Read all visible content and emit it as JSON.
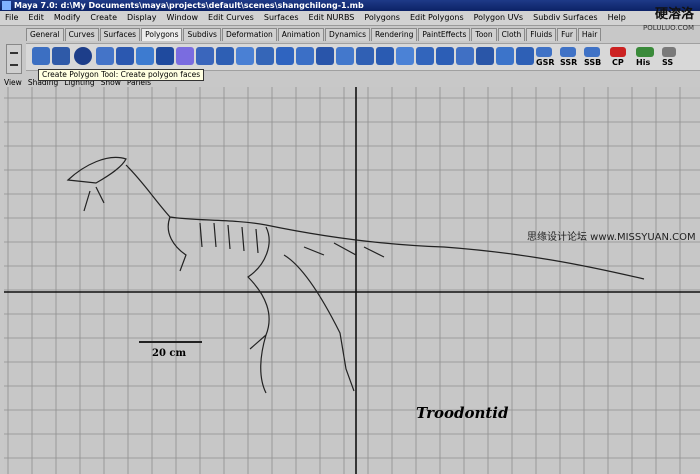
{
  "window": {
    "title": "Maya 7.0: d:\\My Documents\\maya\\projects\\default\\scenes\\shangchilong-1.mb"
  },
  "menus": [
    "File",
    "Edit",
    "Modify",
    "Create",
    "Display",
    "Window",
    "Edit Curves",
    "Surfaces",
    "Edit NURBS",
    "Polygons",
    "Edit Polygons",
    "Polygon UVs",
    "Subdiv Surfaces",
    "Help"
  ],
  "shelf_tabs": [
    "General",
    "Curves",
    "Surfaces",
    "Polygons",
    "Subdivs",
    "Deformation",
    "Animation",
    "Dynamics",
    "Rendering",
    "PaintEffects",
    "Toon",
    "Cloth",
    "Fluids",
    "Fur",
    "Hair"
  ],
  "active_shelf_tab": "Polygons",
  "shelf_text_buttons": [
    "GSR",
    "SSR",
    "SSB",
    "CP",
    "His",
    "SS"
  ],
  "tooltip": "Create Polygon Tool: Create polygon faces",
  "panel_menus": [
    "View",
    "Shading",
    "Lighting",
    "Show",
    "Panels"
  ],
  "image": {
    "scale_label": "20 cm",
    "species_label": "Troodontid"
  },
  "watermark": {
    "logo_top": "硬溶洛",
    "logo_bottom": "POLULUO.COM",
    "site": "思缘设计论坛 www.MISSYUAN.COM"
  },
  "colors": {
    "title_bg": "#0c2266",
    "grid": "#8f8f8f",
    "axis": "#111111",
    "viewport_bg": "#c7c7c7"
  }
}
